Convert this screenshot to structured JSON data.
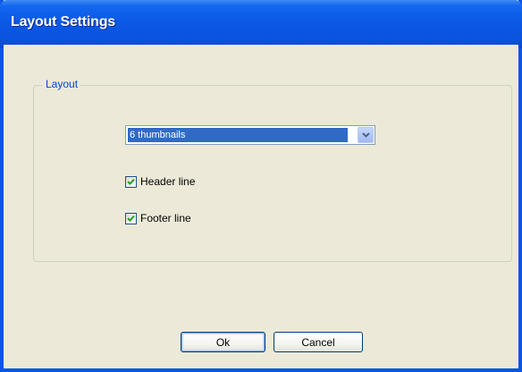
{
  "window": {
    "title": "Layout Settings"
  },
  "layout_group": {
    "legend": "Layout",
    "dropdown": {
      "selected": "6 thumbnails"
    },
    "header_line": {
      "label": "Header line",
      "checked": true
    },
    "footer_line": {
      "label": "Footer line",
      "checked": true
    }
  },
  "buttons": {
    "ok_label": "Ok",
    "cancel_label": "Cancel"
  },
  "icons": {
    "dropdown_arrow": "chevron-down-icon",
    "checkmark": "checkmark-icon"
  },
  "colors": {
    "title_bar": "#0a55e2",
    "dialog_background": "#ece9d8",
    "selection": "#316ac5",
    "checkmark": "#21a121",
    "group_legend": "#0046d5"
  }
}
